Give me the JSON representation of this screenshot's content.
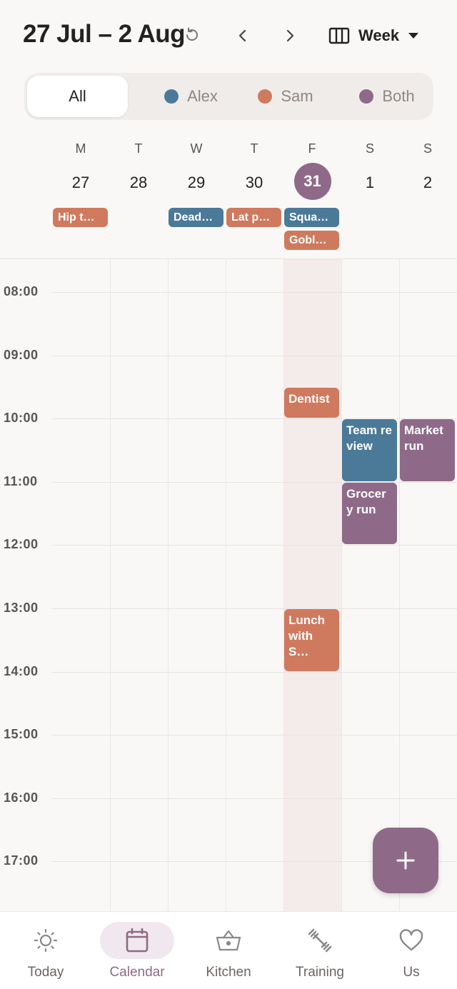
{
  "header": {
    "range_title": "27 Jul – 2 Aug",
    "view_label": "Week"
  },
  "filters": [
    {
      "label": "All",
      "selected": true
    },
    {
      "label": "Alex",
      "color": "#4b7a99"
    },
    {
      "label": "Sam",
      "color": "#cf7a5e"
    },
    {
      "label": "Both",
      "color": "#8e6a88"
    }
  ],
  "colors": {
    "alex": "#4b7a99",
    "sam": "#cf7a5e",
    "both": "#8e6a88",
    "accent": "#8e6a88"
  },
  "days": [
    {
      "dow": "M",
      "num": "27"
    },
    {
      "dow": "T",
      "num": "28"
    },
    {
      "dow": "W",
      "num": "29"
    },
    {
      "dow": "T",
      "num": "30"
    },
    {
      "dow": "F",
      "num": "31",
      "today": true
    },
    {
      "dow": "S",
      "num": "1"
    },
    {
      "dow": "S",
      "num": "2"
    }
  ],
  "allday_events": [
    {
      "day": 0,
      "row": 0,
      "label": "Hip t…",
      "owner": "sam"
    },
    {
      "day": 2,
      "row": 0,
      "label": "Dead…",
      "owner": "alex"
    },
    {
      "day": 3,
      "row": 0,
      "label": "Lat p…",
      "owner": "sam"
    },
    {
      "day": 4,
      "row": 0,
      "label": "Squa…",
      "owner": "alex"
    },
    {
      "day": 4,
      "row": 1,
      "label": "Gobl…",
      "owner": "sam"
    }
  ],
  "hours": [
    "08:00",
    "09:00",
    "10:00",
    "11:00",
    "12:00",
    "13:00",
    "14:00",
    "15:00",
    "16:00",
    "17:00"
  ],
  "events": [
    {
      "day": 4,
      "start": 9.5,
      "end": 10.0,
      "label": "Dentist",
      "owner": "sam"
    },
    {
      "day": 5,
      "start": 10.0,
      "end": 11.0,
      "label": "Team review",
      "owner": "alex"
    },
    {
      "day": 6,
      "start": 10.0,
      "end": 11.0,
      "label": "Market run",
      "owner": "both"
    },
    {
      "day": 5,
      "start": 11.0,
      "end": 12.0,
      "label": "Grocer y run",
      "owner": "both"
    },
    {
      "day": 4,
      "start": 13.0,
      "end": 14.0,
      "label": "Lunch with S…",
      "owner": "sam"
    }
  ],
  "nav": [
    {
      "label": "Today",
      "icon": "sun-icon"
    },
    {
      "label": "Calendar",
      "icon": "calendar-icon",
      "active": true
    },
    {
      "label": "Kitchen",
      "icon": "basket-icon"
    },
    {
      "label": "Training",
      "icon": "dumbbell-icon"
    },
    {
      "label": "Us",
      "icon": "heart-icon"
    }
  ]
}
